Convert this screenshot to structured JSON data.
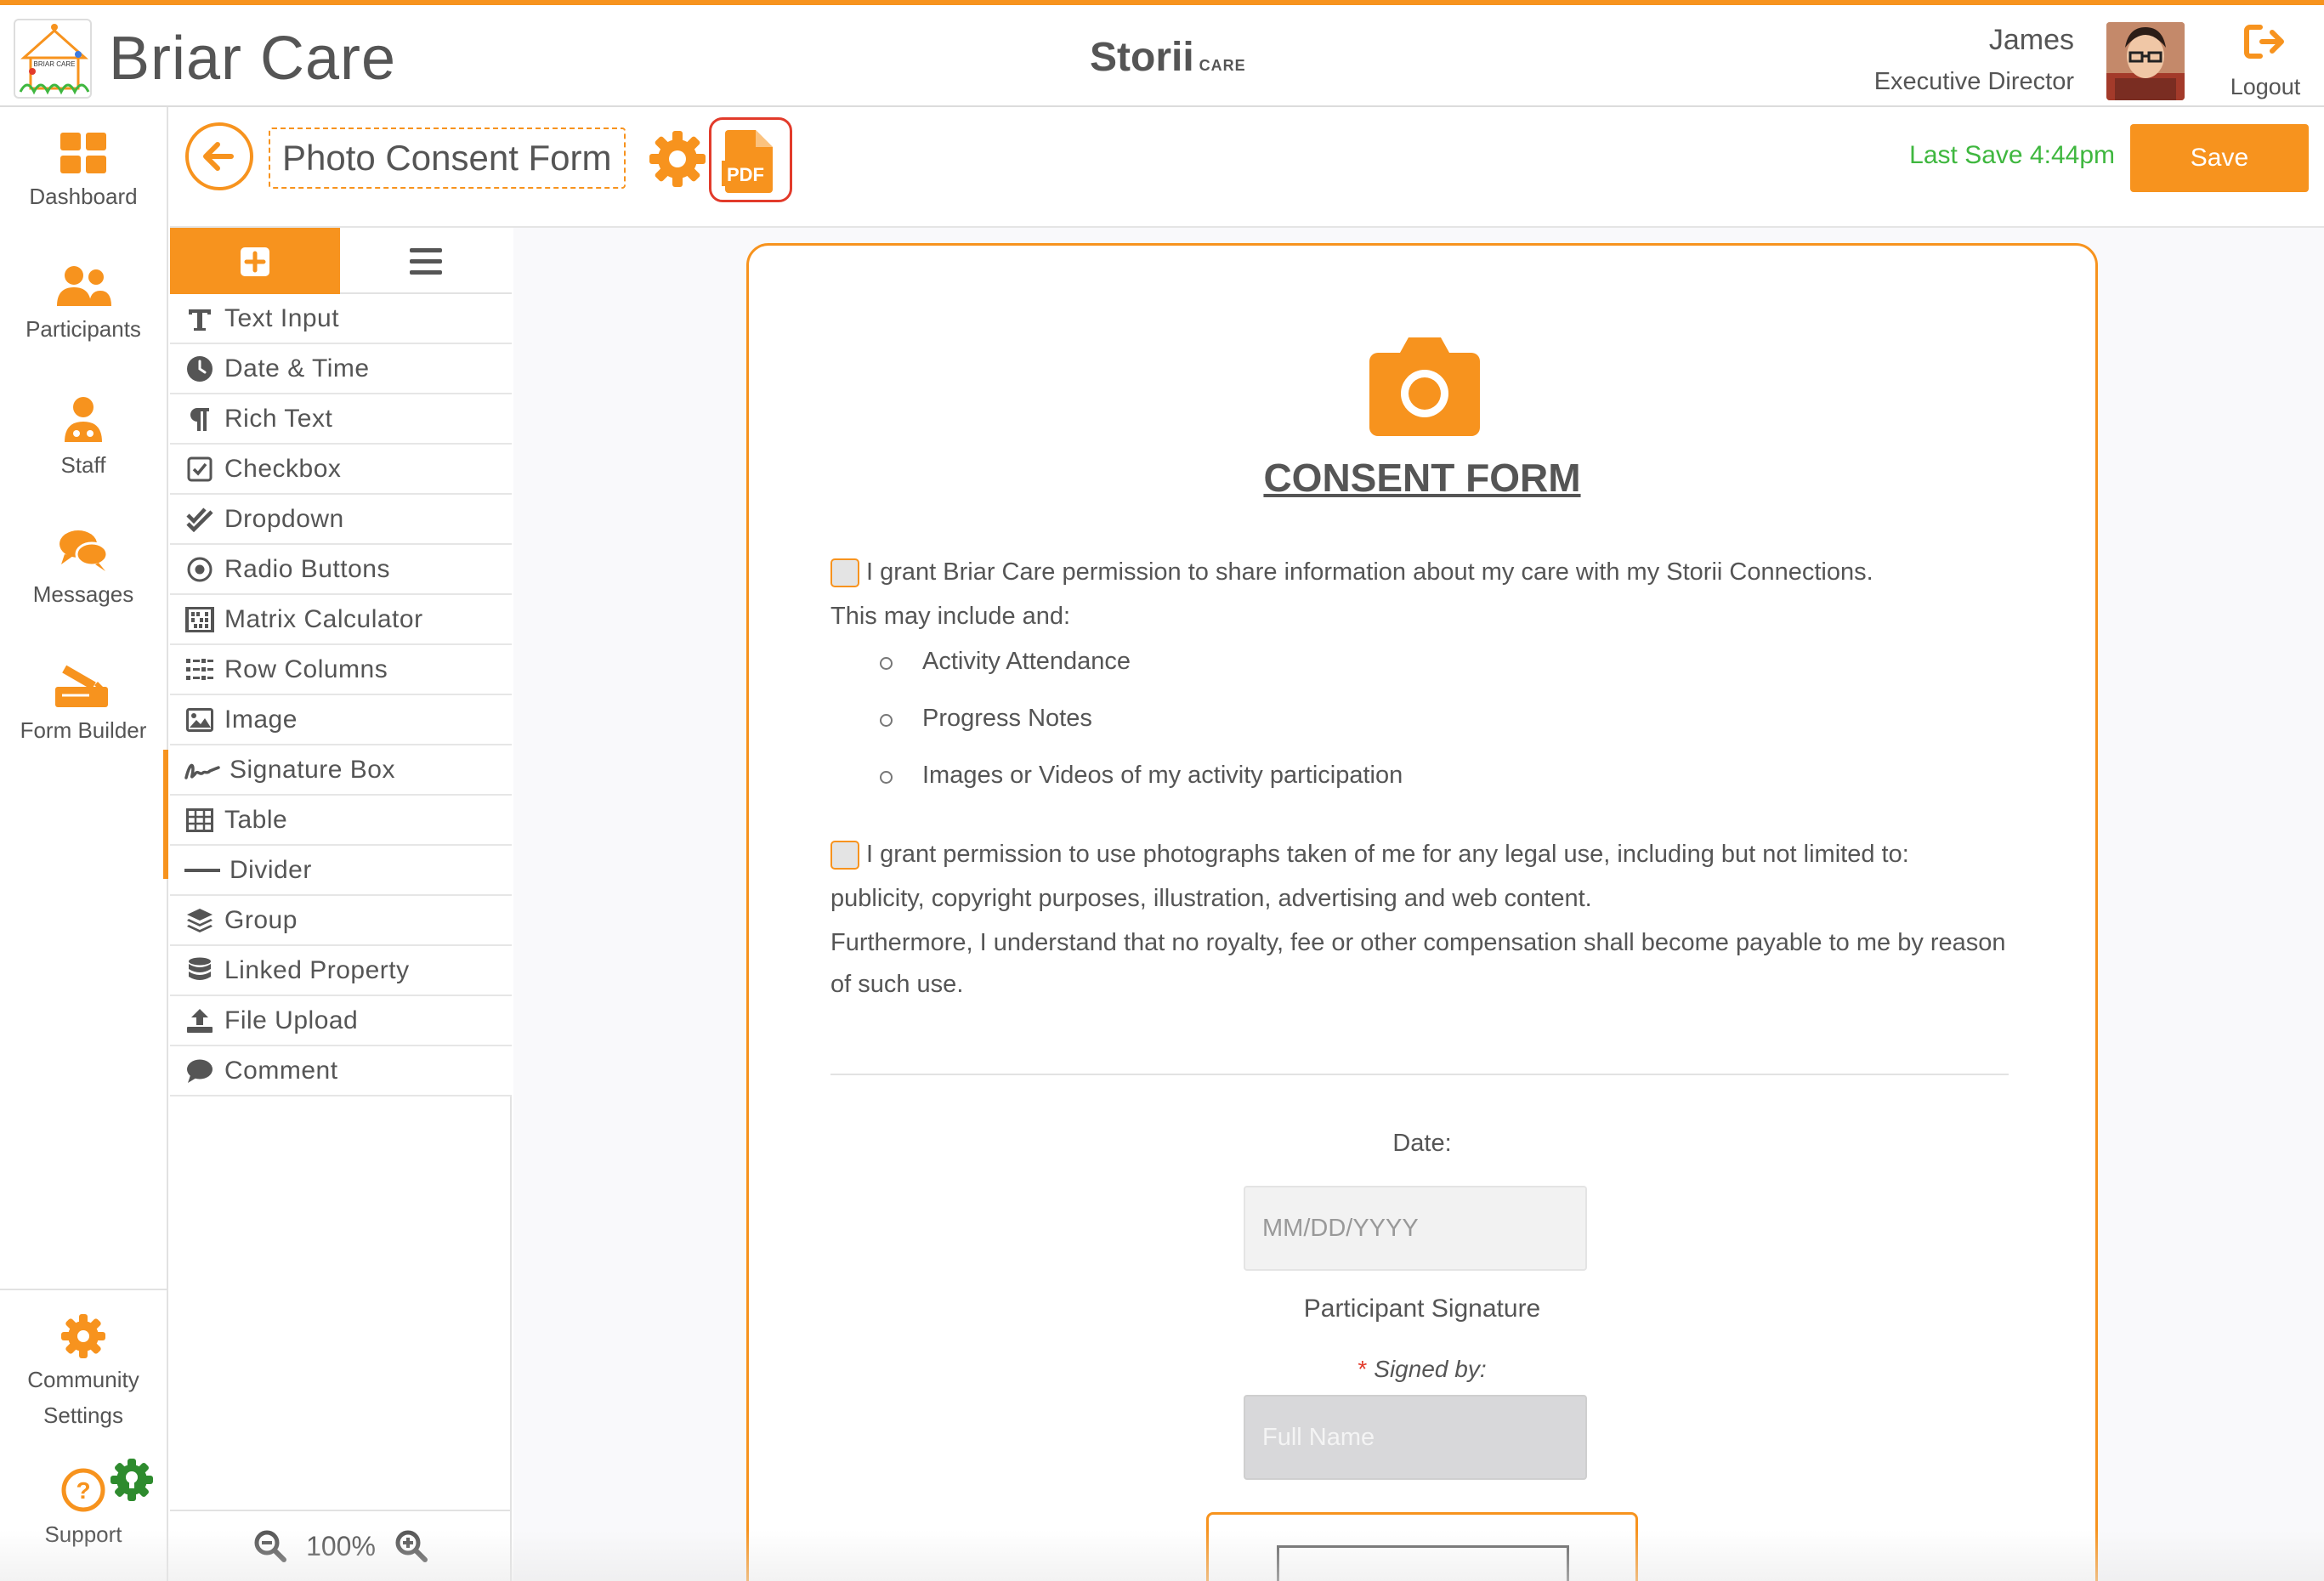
{
  "brand": {
    "name": "Briar Care",
    "logo_text": "BRIAR CARE",
    "product_logo": {
      "main": "Storii",
      "suffix": "CARE"
    }
  },
  "user": {
    "name": "James",
    "role": "Executive Director",
    "logout_label": "Logout"
  },
  "nav": {
    "items": [
      {
        "label": "Dashboard",
        "icon": "dashboard-icon"
      },
      {
        "label": "Participants",
        "icon": "participants-icon"
      },
      {
        "label": "Staff",
        "icon": "staff-icon"
      },
      {
        "label": "Messages",
        "icon": "messages-icon"
      },
      {
        "label": "Form Builder",
        "icon": "form-builder-icon",
        "active": true
      }
    ],
    "bottom": [
      {
        "label": "Community Settings",
        "icon": "gear-icon"
      },
      {
        "label": "Support",
        "icon": "help-icon"
      }
    ]
  },
  "form_header": {
    "title": "Photo Consent Form",
    "last_save": "Last Save 4:44pm",
    "save_label": "Save",
    "pdf_label": "PDF"
  },
  "palette": {
    "items": [
      {
        "label": "Text Input",
        "icon": "text-icon"
      },
      {
        "label": "Date & Time",
        "icon": "clock-icon"
      },
      {
        "label": "Rich Text",
        "icon": "paragraph-icon"
      },
      {
        "label": "Checkbox",
        "icon": "checkbox-icon"
      },
      {
        "label": "Dropdown",
        "icon": "double-check-icon"
      },
      {
        "label": "Radio Buttons",
        "icon": "radio-icon"
      },
      {
        "label": "Matrix Calculator",
        "icon": "abacus-icon"
      },
      {
        "label": "Row Columns",
        "icon": "columns-icon"
      },
      {
        "label": "Image",
        "icon": "image-icon"
      },
      {
        "label": "Signature Box",
        "icon": "signature-icon"
      },
      {
        "label": "Table",
        "icon": "table-icon"
      },
      {
        "label": "Divider",
        "icon": "divider-icon"
      },
      {
        "label": "Group",
        "icon": "layers-icon"
      },
      {
        "label": "Linked Property",
        "icon": "database-icon"
      },
      {
        "label": "File Upload",
        "icon": "upload-icon"
      },
      {
        "label": "Comment",
        "icon": "comment-icon"
      }
    ],
    "zoom": "100%"
  },
  "form": {
    "title": "CONSENT FORM",
    "consent_1": "I grant Briar Care permission to share information about my care with my Storii Connections.",
    "consent_1_cont": "This may include and:",
    "bullets": [
      "Activity Attendance",
      "Progress Notes",
      "Images or Videos of my activity participation"
    ],
    "consent_2": "I grant permission to use photographs taken of me for any legal use, including but not limited to:",
    "consent_2_cont": "publicity, copyright purposes, illustration, advertising and web content.",
    "paragraph": "Furthermore, I understand that no royalty, fee or other compensation shall become payable to me by reason of such use.",
    "date_label": "Date:",
    "date_placeholder": "MM/DD/YYYY",
    "signature_label": "Participant Signature",
    "signed_by_required": "*",
    "signed_by_label": "Signed by:",
    "fullname_placeholder": "Full Name"
  },
  "colors": {
    "accent": "#f7931e",
    "save_status": "#3fb73f",
    "pdf_outline": "#e23b2b",
    "text": "#555555"
  }
}
